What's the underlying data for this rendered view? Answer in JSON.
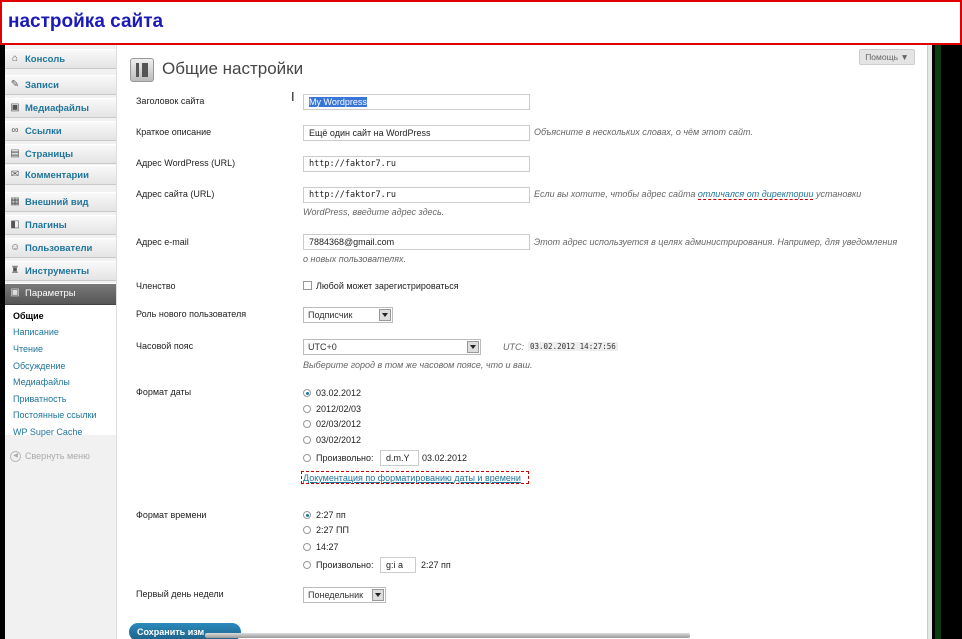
{
  "banner": {
    "title": "настройка сайта"
  },
  "sidebar": {
    "items": [
      {
        "label": "Консоль",
        "icon": "home-icon"
      },
      {
        "label": "Записи",
        "icon": "pin-icon"
      },
      {
        "label": "Медиафайлы",
        "icon": "media-icon"
      },
      {
        "label": "Ссылки",
        "icon": "link-icon"
      },
      {
        "label": "Страницы",
        "icon": "page-icon"
      },
      {
        "label": "Комментарии",
        "icon": "comment-icon"
      },
      {
        "label": "Внешний вид",
        "icon": "appearance-icon"
      },
      {
        "label": "Плагины",
        "icon": "plugin-icon"
      },
      {
        "label": "Пользователи",
        "icon": "users-icon"
      },
      {
        "label": "Инструменты",
        "icon": "tools-icon"
      },
      {
        "label": "Параметры",
        "icon": "settings-icon"
      }
    ],
    "submenu": [
      "Общие",
      "Написание",
      "Чтение",
      "Обсуждение",
      "Медиафайлы",
      "Приватность",
      "Постоянные ссылки",
      "WP Super Cache"
    ],
    "collapse_label": "Свернуть меню"
  },
  "header": {
    "help": "Помощь ▼",
    "title": "Общие настройки"
  },
  "form": {
    "site_title": {
      "label": "Заголовок сайта",
      "value": "My Wordpress"
    },
    "tagline": {
      "label": "Краткое описание",
      "value": "Ещё один сайт на WordPress",
      "desc": "Объясните в нескольких словах, о чём этот сайт."
    },
    "wp_url": {
      "label": "Адрес WordPress (URL)",
      "value": "http://faktor7.ru"
    },
    "site_url": {
      "label": "Адрес сайта (URL)",
      "value": "http://faktor7.ru",
      "desc1": "Если вы хотите, чтобы адрес сайта",
      "desc_link": "отличался от директории",
      "desc2": "установки",
      "desc3": "WordPress, введите адрес здесь."
    },
    "email": {
      "label": "Адрес e-mail",
      "value": "7884368@gmail.com",
      "desc1": "Этот адрес используется в целях администрирования. Например, для уведомления",
      "desc2": "о новых пользователях."
    },
    "membership": {
      "label": "Членство",
      "checkbox_label": "Любой может зарегистрироваться",
      "checked": false
    },
    "default_role": {
      "label": "Роль нового пользователя",
      "value": "Подписчик"
    },
    "timezone": {
      "label": "Часовой пояс",
      "value": "UTC+0",
      "utc_label": "UTC:",
      "utc_time": "03.02.2012 14:27:56",
      "desc": "Выберите город в том же часовом поясе, что и ваш."
    },
    "date_format": {
      "label": "Формат даты",
      "options": [
        "03.02.2012",
        "2012/02/03",
        "02/03/2012",
        "03/02/2012"
      ],
      "selected": 0,
      "custom_label": "Произвольно:",
      "custom_value": "d.m.Y",
      "custom_preview": "03.02.2012",
      "doc_link": "Документация по форматированию даты и времени"
    },
    "time_format": {
      "label": "Формат времени",
      "options": [
        "2:27 пп",
        "2:27 ПП",
        "14:27"
      ],
      "selected": 0,
      "custom_label": "Произвольно:",
      "custom_value": "g:i a",
      "custom_preview": "2:27 пп"
    },
    "week_start": {
      "label": "Первый день недели",
      "value": "Понедельник"
    }
  },
  "save_button": "Сохранить изм"
}
